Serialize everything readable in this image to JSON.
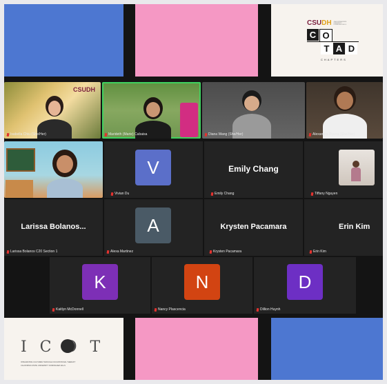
{
  "colors": {
    "blue": "#4d77d1",
    "pink": "#f598c4",
    "cream": "#f7f3ee",
    "gallery_bg": "#141414",
    "tile_bg": "#232323",
    "active_border": "#3fd15f",
    "mic_muted": "#e0322f"
  },
  "top_logo": {
    "brand": "CSUDH",
    "tagline": "CALIFORNIA STATE UNIVERSITY DOMINGUEZ HILLS",
    "letters": [
      "C",
      "O",
      "T",
      "A",
      "D"
    ],
    "subtitle": "CHAPTERS"
  },
  "video_participants": [
    {
      "name": "Isabella Chiu (She/Her)",
      "icon": "video-feed",
      "brand_overlay": "CSUDH"
    },
    {
      "name": "Marideth (Marie) Cabaisa",
      "icon": "video-feed",
      "active_speaker": true
    },
    {
      "name": "Diana Wang (She/Her)",
      "icon": "video-feed"
    },
    {
      "name": "Alexandra Rivera (She/Her)",
      "icon": "video-feed"
    },
    {
      "name": "",
      "icon": "video-feed"
    }
  ],
  "avatar_participants": [
    {
      "initial": "V",
      "name": "Vivian Du",
      "color": "#5b6fc9"
    },
    {
      "initial": "A",
      "name": "Alexa Martinez",
      "color": "#4a5a66"
    },
    {
      "initial": "K",
      "name": "Kaitlyn McDonnell",
      "color": "#7d2fb6"
    },
    {
      "initial": "N",
      "name": "Nancy Plascencia",
      "color": "#d24412"
    },
    {
      "initial": "D",
      "name": "Dillion Huynh",
      "color": "#6d2fc4"
    }
  ],
  "name_only_participants": [
    {
      "display": "Emily Chang",
      "name": "Emily Chang"
    },
    {
      "display": "Larissa  Bolanos...",
      "name": "Larissa Bolanos C20 Section 1"
    },
    {
      "display": "Krysten Pacamara",
      "name": "Krysten Pacamara"
    },
    {
      "display": "Erin Kim",
      "name": "Erin Kim"
    }
  ],
  "photo_participant": {
    "name": "Tiffany Nguyen",
    "icon": "profile-photo"
  },
  "bottom_logo": {
    "letters": "I C O T",
    "line1": "INTEGRATING CULTURES THROUGH OCCUPATIONAL THERAPY",
    "line2": "CALIFORNIA STATE UNIVERSITY DOMINGUEZ HILLS"
  }
}
